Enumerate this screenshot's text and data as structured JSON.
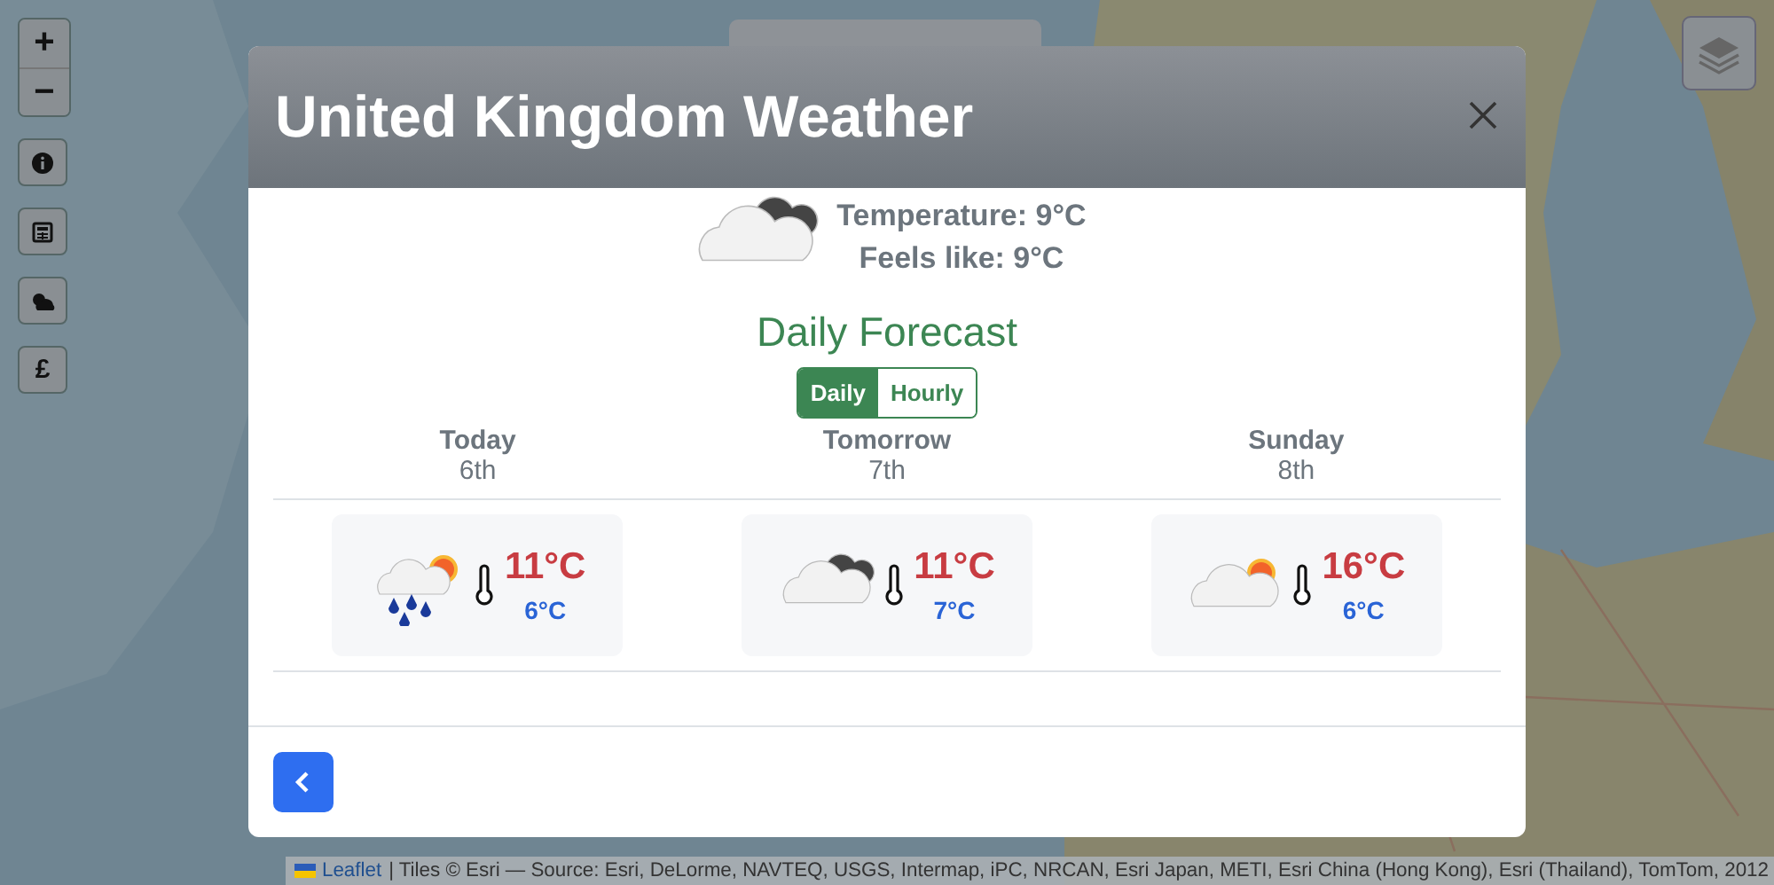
{
  "map": {
    "kind": "picture"
  },
  "zoom_controls": [
    "+",
    "−"
  ],
  "map_buttons": [
    {
      "kind": "info"
    },
    {
      "kind": "news"
    },
    {
      "kind": "weather"
    },
    {
      "kind": "currency",
      "label": "£"
    }
  ],
  "modal": {
    "title": "United Kingdom Weather",
    "current": {
      "kind": "cloudy",
      "temperature": "Temperature: 9°C",
      "feels_like": "Feels like: 9°C"
    },
    "forecast_title": "Daily Forecast",
    "view_tabs": [
      {
        "label": "Daily",
        "selected": true
      },
      {
        "label": "Hourly",
        "selected": false
      }
    ],
    "days": [
      {
        "day": "Today",
        "date": "6th",
        "kind": "rain-sun",
        "high": "11°C",
        "low": "6°C"
      },
      {
        "day": "Tomorrow",
        "date": "7th",
        "kind": "cloudy",
        "high": "11°C",
        "low": "7°C"
      },
      {
        "day": "Sunday",
        "date": "8th",
        "kind": "cloud-sun",
        "high": "16°C",
        "low": "6°C"
      }
    ]
  },
  "attribution": {
    "link": "Leaflet",
    "text": "| Tiles © Esri — Source: Esri, DeLorme, NAVTEQ, USGS, Intermap, iPC, NRCAN, Esri Japan, METI, Esri China (Hong Kong), Esri (Thailand), TomTom, 2012"
  }
}
